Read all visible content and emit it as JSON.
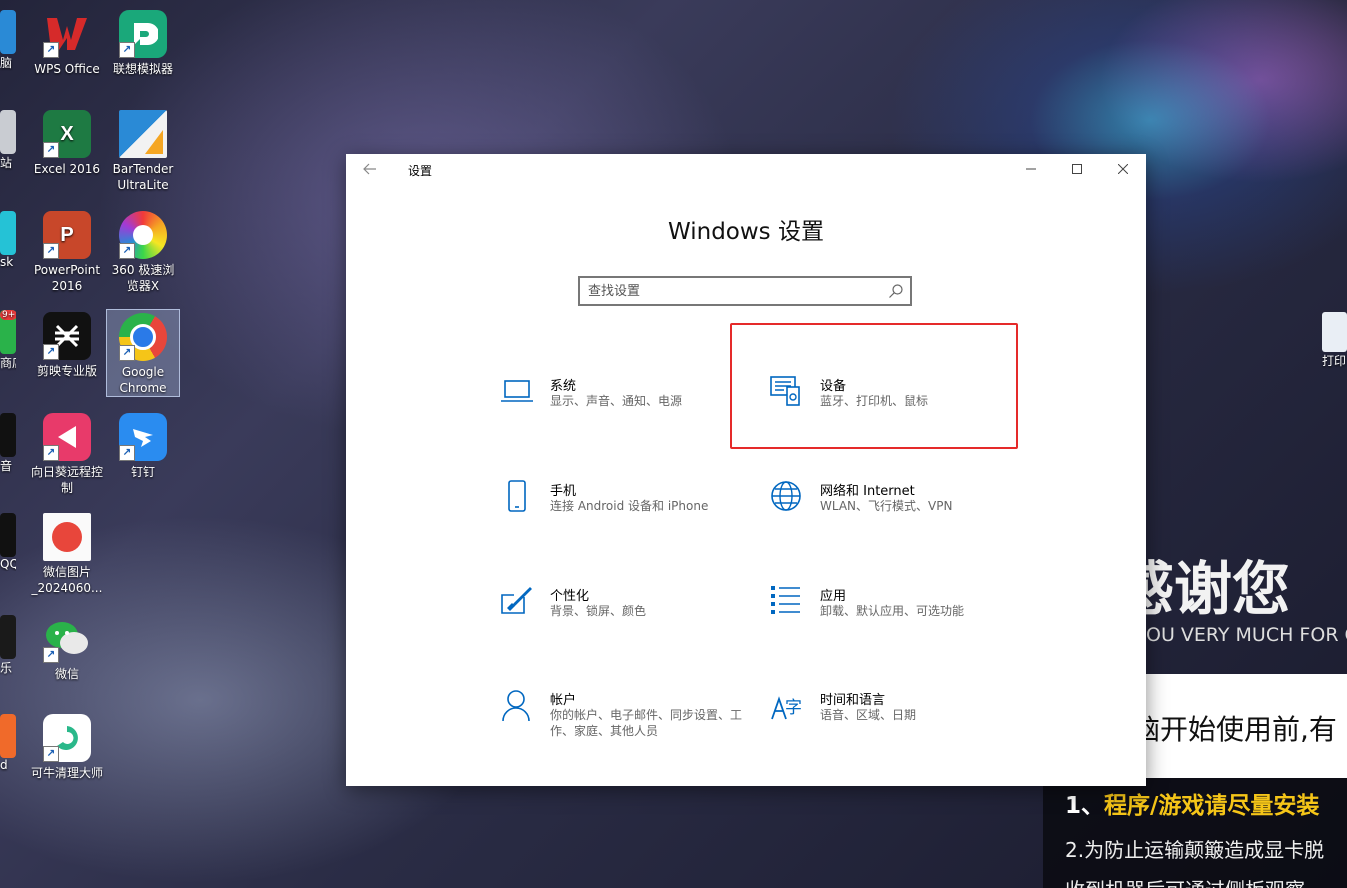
{
  "desktop": {
    "icons": [
      {
        "label": "WPS Office",
        "glyph": "W",
        "color": "#d62a2a"
      },
      {
        "label": "联想模拟器",
        "glyph": "D",
        "color": "#1aa87a"
      },
      {
        "label": "Excel 2016",
        "glyph": "X",
        "color": "#1e7a43"
      },
      {
        "label": "BarTender UltraLite",
        "glyph": "",
        "color": "#2a8ad6"
      },
      {
        "label": "PowerPoint 2016",
        "glyph": "P",
        "color": "#c8472a"
      },
      {
        "label": "360 极速浏览器X",
        "glyph": "",
        "color": "#f28a1a"
      },
      {
        "label": "剪映专业版",
        "glyph": "✂",
        "color": "#111111"
      },
      {
        "label": "Google Chrome",
        "glyph": "",
        "color": "#e8463b"
      },
      {
        "label": "向日葵远程控制",
        "glyph": "◀",
        "color": "#e83a6a"
      },
      {
        "label": "钉钉",
        "glyph": "➤",
        "color": "#2a8cf0"
      },
      {
        "label": "微信图片_2024060...",
        "glyph": "",
        "color": "#f0f0f0"
      },
      {
        "label": "微信",
        "glyph": "●",
        "color": "#2ab24a"
      },
      {
        "label": "可牛清理大师",
        "glyph": "",
        "color": "#2ab88a"
      }
    ],
    "left_clipped_labels": [
      "脑",
      "站",
      "sk",
      "商店",
      "音",
      "QQ",
      "乐",
      "d"
    ],
    "left_badge": "9+",
    "right_clipped_label": "打印",
    "promo": {
      "headline": "感谢您",
      "subline": "OU VERY MUCH FOR C",
      "bar_text": "脑开始使用前,有",
      "line1_prefix": "1、",
      "line1_highlight": "程序/游戏请尽量安装",
      "line2": "2.为防止运输颠簸造成显卡脱",
      "line3": "收到机器后可通过侧板观察"
    }
  },
  "settings_window": {
    "title": "设置",
    "heading": "Windows 设置",
    "search": {
      "placeholder": "查找设置"
    },
    "tiles": [
      {
        "id": "system",
        "name": "系统",
        "desc": "显示、声音、通知、电源",
        "icon": "laptop-icon"
      },
      {
        "id": "devices",
        "name": "设备",
        "desc": "蓝牙、打印机、鼠标",
        "icon": "devices-icon"
      },
      {
        "id": "phone",
        "name": "手机",
        "desc": "连接 Android 设备和 iPhone",
        "icon": "phone-icon"
      },
      {
        "id": "network",
        "name": "网络和 Internet",
        "desc": "WLAN、飞行模式、VPN",
        "icon": "globe-icon"
      },
      {
        "id": "personalization",
        "name": "个性化",
        "desc": "背景、锁屏、颜色",
        "icon": "paint-icon"
      },
      {
        "id": "apps",
        "name": "应用",
        "desc": "卸载、默认应用、可选功能",
        "icon": "apps-icon"
      },
      {
        "id": "accounts",
        "name": "帐户",
        "desc": "你的帐户、电子邮件、同步设置、工作、家庭、其他人员",
        "icon": "person-icon"
      },
      {
        "id": "time",
        "name": "时间和语言",
        "desc": "语音、区域、日期",
        "icon": "time-language-icon"
      }
    ]
  },
  "colors": {
    "accent": "#0067c0",
    "highlight_box": "#e52a2a",
    "promo_yellow": "#f5c518"
  }
}
